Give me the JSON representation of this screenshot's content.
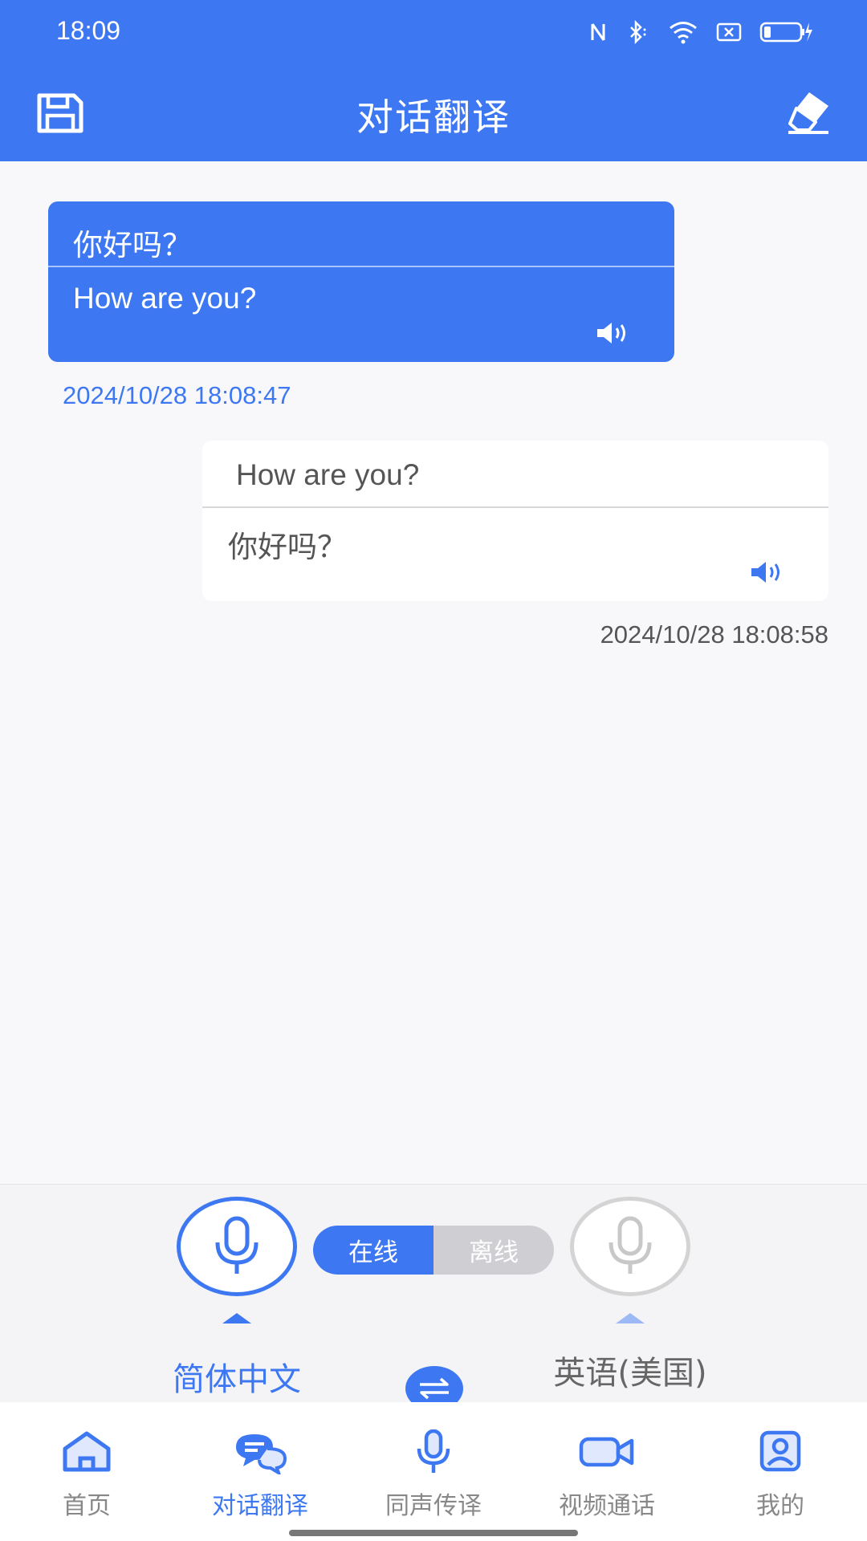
{
  "status_bar": {
    "time": "18:09"
  },
  "header": {
    "title": "对话翻译"
  },
  "messages": [
    {
      "source": "你好吗？",
      "translation": "How are you?",
      "timestamp": "2024/10/28 18:08:47"
    },
    {
      "source": "How are you?",
      "translation": "你好吗？",
      "timestamp": "2024/10/28 18:08:58"
    }
  ],
  "controls": {
    "online_label": "在线",
    "offline_label": "离线",
    "left_language": "简体中文",
    "right_language": "英语(美国)"
  },
  "nav": {
    "items": [
      {
        "label": "首页",
        "icon": "home-icon"
      },
      {
        "label": "对话翻译",
        "icon": "chat-icon"
      },
      {
        "label": "同声传译",
        "icon": "mic-icon"
      },
      {
        "label": "视频通话",
        "icon": "video-icon"
      },
      {
        "label": "我的",
        "icon": "profile-icon"
      }
    ],
    "active_index": 1
  },
  "colors": {
    "primary": "#3d78f2",
    "inactive": "#888888",
    "background": "#f8f8fa"
  }
}
